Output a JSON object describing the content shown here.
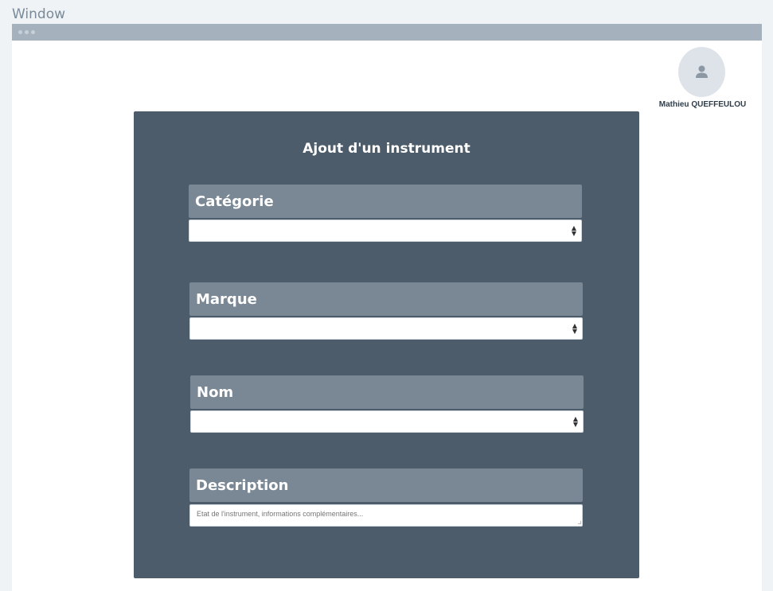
{
  "window": {
    "title": "Window"
  },
  "user": {
    "name": "Mathieu QUEFFEULOU",
    "avatar_icon": "user-icon"
  },
  "form": {
    "title": "Ajout d'un instrument",
    "fields": {
      "categorie": {
        "label": "Catégorie",
        "value": ""
      },
      "marque": {
        "label": "Marque",
        "value": ""
      },
      "nom": {
        "label": "Nom",
        "value": ""
      },
      "description": {
        "label": "Description",
        "value": "",
        "placeholder": "Etat de l'instrument, informations complémentaires..."
      }
    }
  },
  "colors": {
    "panel": "#4d5c6a",
    "field_header": "#7a8794",
    "titlebar": "#a5b1bc",
    "background": "#eff3f6"
  }
}
